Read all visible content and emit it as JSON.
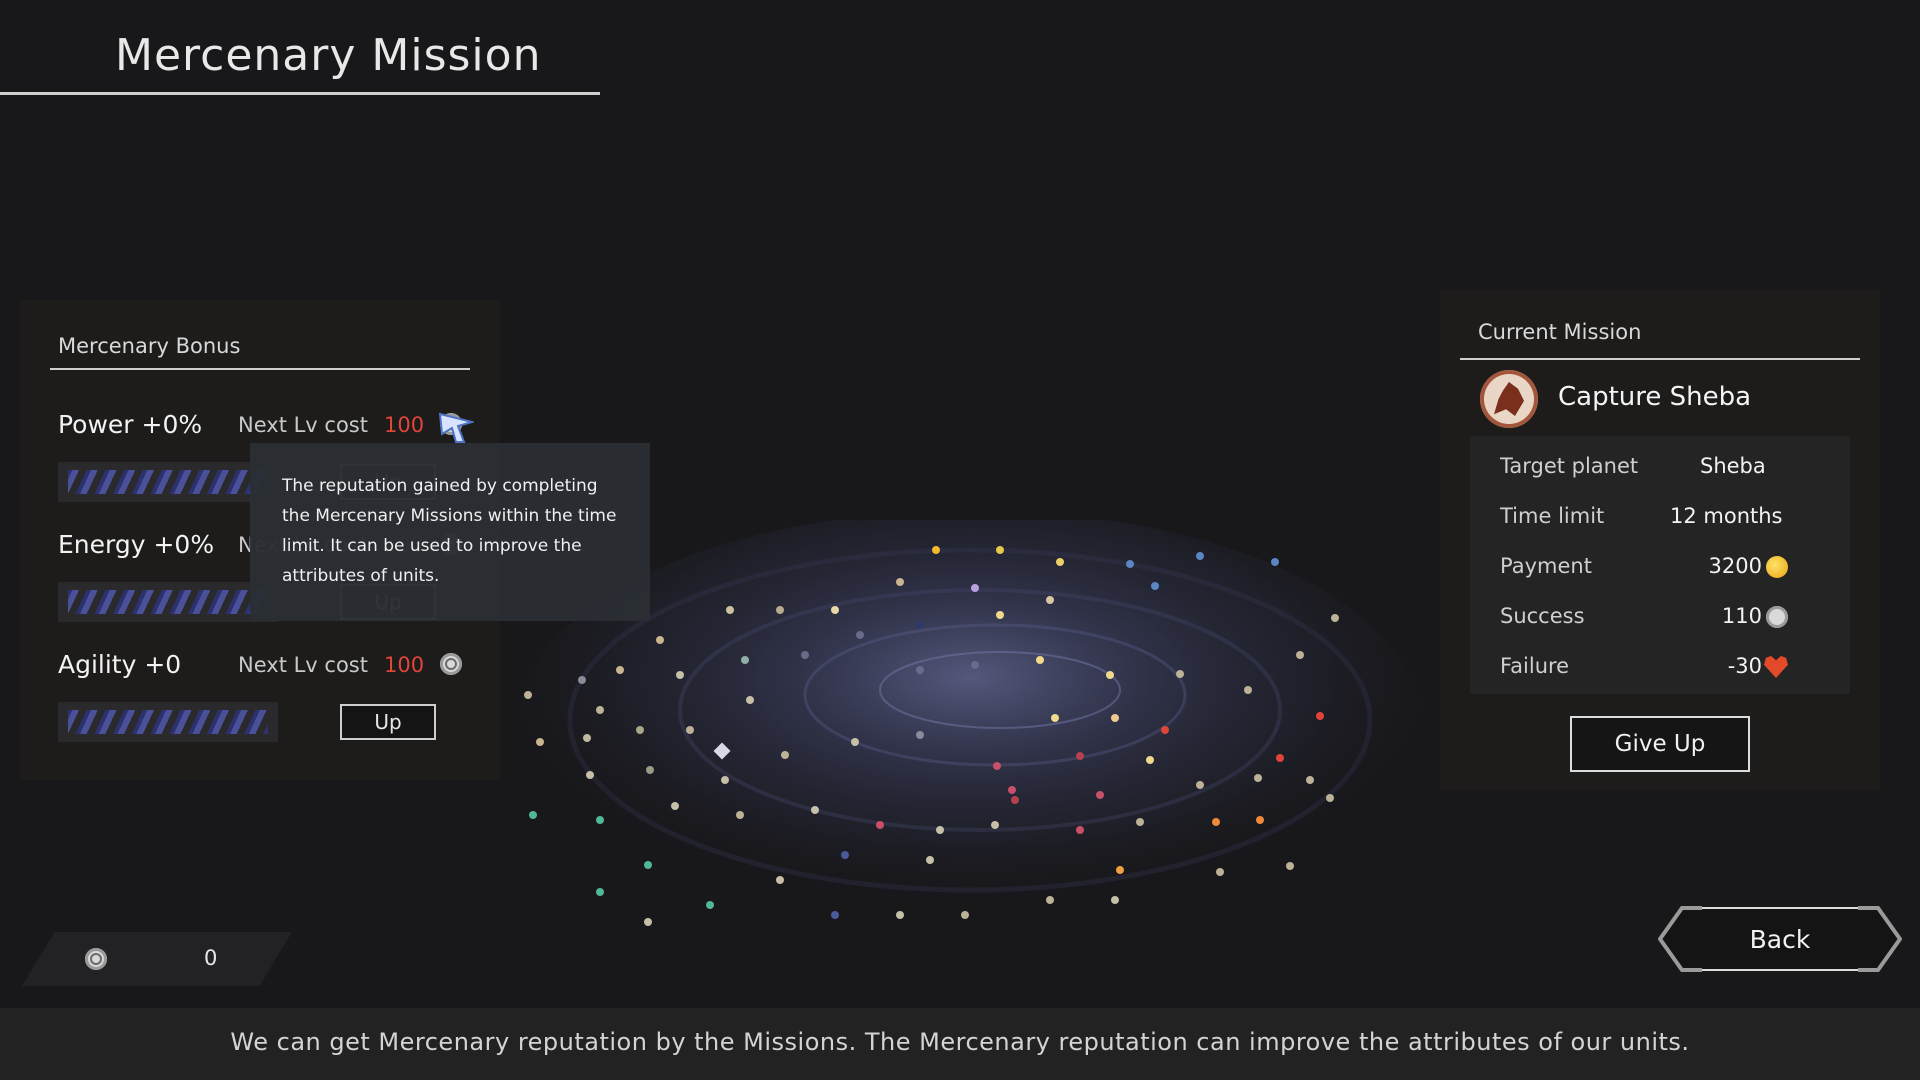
{
  "title": "Mercenary Mission",
  "bonus_panel": {
    "heading": "Mercenary Bonus",
    "cost_label": "Next Lv cost",
    "up_label": "Up",
    "attributes": [
      {
        "name": "Power +0%",
        "cost": "100",
        "level": 0.0
      },
      {
        "name": "Energy +0%",
        "cost": "100",
        "level": 0.0
      },
      {
        "name": "Agility +0",
        "cost": "100",
        "level": 0.0
      }
    ]
  },
  "tooltip": "The reputation gained by completing the Mercenary Missions within the time limit. It can be used to improve the attributes of units.",
  "reputation_count": "0",
  "mission_panel": {
    "heading": "Current Mission",
    "mission_name": "Capture Sheba",
    "rows": [
      {
        "label": "Target planet",
        "value": "Sheba"
      },
      {
        "label": "Time limit",
        "value": "12 months"
      },
      {
        "label": "Payment",
        "value": "3200",
        "icon": "coin-icon"
      },
      {
        "label": "Success",
        "value": "110",
        "icon": "reputation-icon"
      },
      {
        "label": "Failure",
        "value": "-30",
        "icon": "heart-icon"
      }
    ],
    "give_up_label": "Give Up"
  },
  "back_label": "Back",
  "hint": "We can get Mercenary reputation by the Missions. The Mercenary reputation can improve the attributes of our units.",
  "colors": {
    "background": "#18181b",
    "panel": "#1d1c1b",
    "cost_red": "#e0453a",
    "bar_fill": "#4b5199",
    "coin": "#f2c12e",
    "heart": "#e34a2a"
  }
}
